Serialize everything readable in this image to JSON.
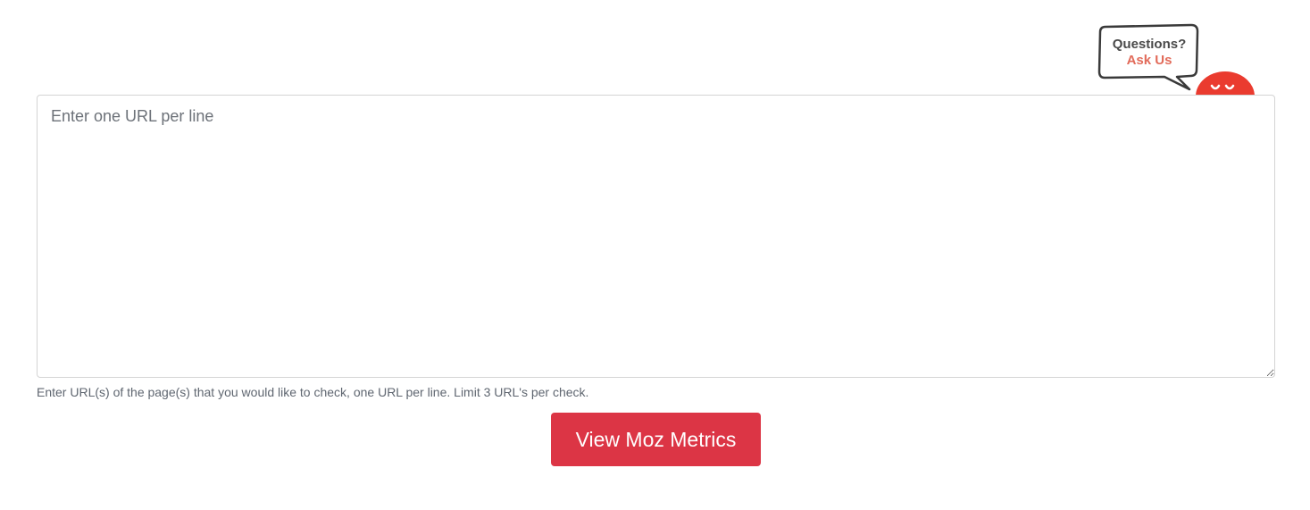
{
  "ask_widget": {
    "line1": "Questions?",
    "line2": "Ask Us",
    "icon": "chat-mascot-icon",
    "mascot_color": "#ea3b2f"
  },
  "url_input": {
    "placeholder": "Enter one URL per line",
    "value": ""
  },
  "help_text": "Enter URL(s) of the page(s) that you would like to check, one URL per line. Limit 3 URL's per check.",
  "submit_button": {
    "label": "View Moz Metrics",
    "color": "#dc3545"
  }
}
